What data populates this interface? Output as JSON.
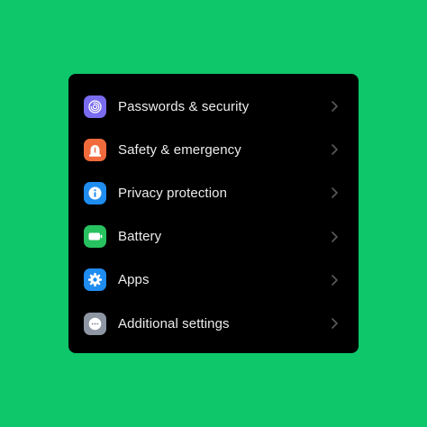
{
  "settings": {
    "items": [
      {
        "label": "Passwords & security",
        "icon": "fingerprint-icon",
        "color": "#7a6cf0"
      },
      {
        "label": "Safety & emergency",
        "icon": "alarm-light-icon",
        "color": "#f06a3c"
      },
      {
        "label": "Privacy protection",
        "icon": "privacy-info-icon",
        "color": "#1f8cf0"
      },
      {
        "label": "Battery",
        "icon": "battery-icon",
        "color": "#27c25f"
      },
      {
        "label": "Apps",
        "icon": "gear-icon",
        "color": "#1f8cf0"
      },
      {
        "label": "Additional settings",
        "icon": "more-dots-icon",
        "color": "#8e96a4"
      }
    ]
  },
  "colors": {
    "background": "#0dc76a",
    "panel": "#000000",
    "text": "#ececec",
    "chevron": "#5a5a5a"
  }
}
